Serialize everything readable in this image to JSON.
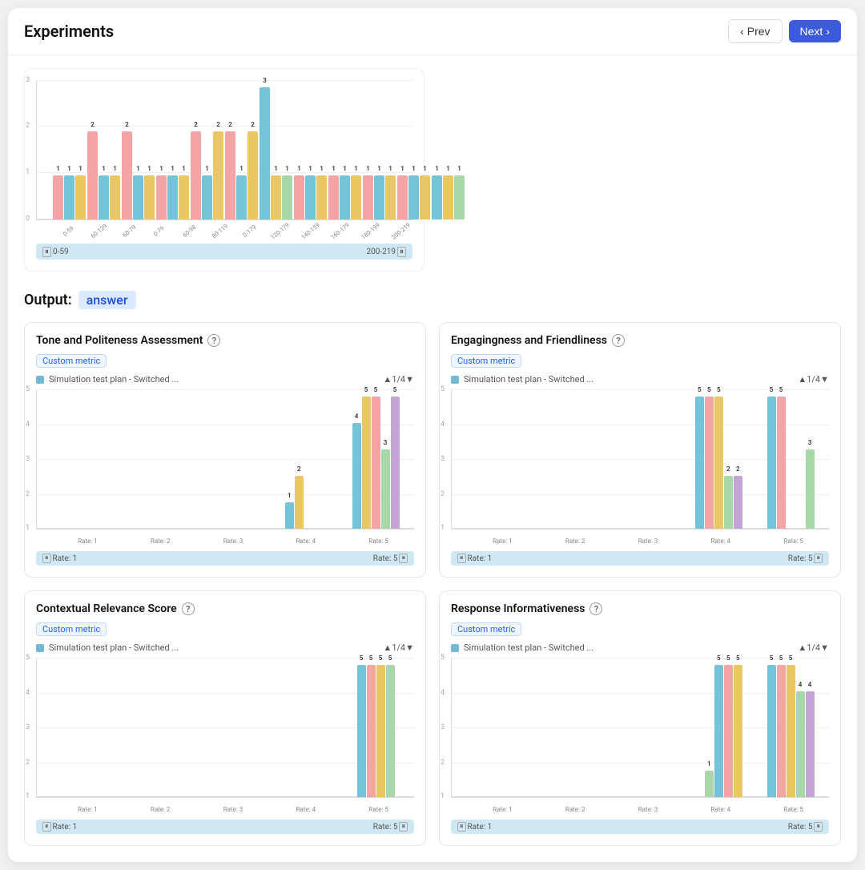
{
  "header": {
    "title": "Experiments",
    "prev_label": "Prev",
    "next_label": "Next"
  },
  "output_label": "Output:",
  "output_badge": "answer",
  "top_chart": {
    "y_labels": [
      "0",
      "1",
      "2",
      "3"
    ],
    "groups": [
      {
        "label": "0-59",
        "bars": [
          {
            "v": 1,
            "c": "#f4a4a4"
          },
          {
            "v": 1,
            "c": "#74c4d8"
          },
          {
            "v": 1,
            "c": "#ebc664"
          }
        ]
      },
      {
        "label": "60-139",
        "bars": [
          {
            "v": 2,
            "c": "#f4a4a4"
          },
          {
            "v": 1,
            "c": "#74c4d8"
          },
          {
            "v": 1,
            "c": "#ebc664"
          }
        ]
      },
      {
        "label": "60-79",
        "bars": [
          {
            "v": 2,
            "c": "#f4a4a4"
          },
          {
            "v": 1,
            "c": "#74c4d8"
          },
          {
            "v": 1,
            "c": "#ebc664"
          }
        ]
      },
      {
        "label": "0-79",
        "bars": [
          {
            "v": 1,
            "c": "#f4a4a4"
          },
          {
            "v": 1,
            "c": "#74c4d8"
          },
          {
            "v": 1,
            "c": "#ebc664"
          }
        ]
      },
      {
        "label": "60-98",
        "bars": [
          {
            "v": 2,
            "c": "#f4a4a4"
          },
          {
            "v": 1,
            "c": "#74c4d8"
          },
          {
            "v": 2,
            "c": "#ebc664"
          }
        ]
      },
      {
        "label": "80-119",
        "bars": [
          {
            "v": 2,
            "c": "#f4a4a4"
          },
          {
            "v": 1,
            "c": "#74c4d8"
          },
          {
            "v": 2,
            "c": "#ebc664"
          }
        ]
      },
      {
        "label": "0-179",
        "bars": [
          {
            "v": 3,
            "c": "#74c4d8"
          },
          {
            "v": 1,
            "c": "#ebc664"
          },
          {
            "v": 1,
            "c": "#a8d8a8"
          }
        ]
      },
      {
        "label": "120-179",
        "bars": [
          {
            "v": 1,
            "c": "#f4a4a4"
          },
          {
            "v": 1,
            "c": "#74c4d8"
          },
          {
            "v": 1,
            "c": "#ebc664"
          }
        ]
      },
      {
        "label": "140-159",
        "bars": [
          {
            "v": 1,
            "c": "#f4a4a4"
          },
          {
            "v": 1,
            "c": "#74c4d8"
          },
          {
            "v": 1,
            "c": "#ebc664"
          }
        ]
      },
      {
        "label": "160-179",
        "bars": [
          {
            "v": 1,
            "c": "#f4a4a4"
          },
          {
            "v": 1,
            "c": "#74c4d8"
          },
          {
            "v": 1,
            "c": "#ebc664"
          }
        ]
      },
      {
        "label": "180-199",
        "bars": [
          {
            "v": 1,
            "c": "#f4a4a4"
          },
          {
            "v": 1,
            "c": "#74c4d8"
          },
          {
            "v": 1,
            "c": "#ebc664"
          }
        ]
      },
      {
        "label": "200-219",
        "bars": [
          {
            "v": 1,
            "c": "#74c4d8"
          },
          {
            "v": 1,
            "c": "#ebc664"
          },
          {
            "v": 1,
            "c": "#a8d8a8"
          }
        ]
      }
    ],
    "slider_left": "0-59",
    "slider_right": "200-219"
  },
  "metrics": [
    {
      "id": "tone",
      "title": "Tone and Politeness Assessment",
      "badge": "Custom metric",
      "legend": "Simulation test plan - Switched ...",
      "nav": "▲1/4▼",
      "rates": [
        {
          "label": "Rate: 1",
          "bars": [
            {
              "v": 0,
              "c": "#f4a4a4"
            },
            {
              "v": 0,
              "c": "#74c4d8"
            },
            {
              "v": 0,
              "c": "#ebc664"
            },
            {
              "v": 0,
              "c": "#a8d8a8"
            }
          ]
        },
        {
          "label": "Rate: 2",
          "bars": [
            {
              "v": 0,
              "c": "#f4a4a4"
            },
            {
              "v": 0,
              "c": "#74c4d8"
            },
            {
              "v": 0,
              "c": "#ebc664"
            },
            {
              "v": 0,
              "c": "#a8d8a8"
            }
          ]
        },
        {
          "label": "Rate: 3",
          "bars": [
            {
              "v": 0,
              "c": "#f4a4a4"
            },
            {
              "v": 0,
              "c": "#74c4d8"
            },
            {
              "v": 0,
              "c": "#ebc664"
            },
            {
              "v": 0,
              "c": "#a8d8a8"
            }
          ]
        },
        {
          "label": "Rate: 4",
          "bars": [
            {
              "v": 1,
              "c": "#74c4d8"
            },
            {
              "v": 2,
              "c": "#ebc664"
            },
            {
              "v": 0,
              "c": "#f4a4a4"
            },
            {
              "v": 0,
              "c": "#a8d8a8"
            }
          ]
        },
        {
          "label": "Rate: 5",
          "bars": [
            {
              "v": 4,
              "c": "#74c4d8"
            },
            {
              "v": 5,
              "c": "#ebc664"
            },
            {
              "v": 5,
              "c": "#f4a4a4"
            },
            {
              "v": 3,
              "c": "#a8d8a8"
            },
            {
              "v": 5,
              "c": "#c4a4d4"
            }
          ]
        }
      ],
      "slider_left": "Rate: 1",
      "slider_right": "Rate: 5"
    },
    {
      "id": "engagingness",
      "title": "Engagingness and Friendliness",
      "badge": "Custom metric",
      "legend": "Simulation test plan - Switched ...",
      "nav": "▲1/4▼",
      "rates": [
        {
          "label": "Rate: 1",
          "bars": [
            {
              "v": 0,
              "c": "#f4a4a4"
            },
            {
              "v": 0,
              "c": "#74c4d8"
            },
            {
              "v": 0,
              "c": "#ebc664"
            },
            {
              "v": 0,
              "c": "#a8d8a8"
            }
          ]
        },
        {
          "label": "Rate: 2",
          "bars": [
            {
              "v": 0,
              "c": "#f4a4a4"
            },
            {
              "v": 0,
              "c": "#74c4d8"
            },
            {
              "v": 0,
              "c": "#ebc664"
            },
            {
              "v": 0,
              "c": "#a8d8a8"
            }
          ]
        },
        {
          "label": "Rate: 3",
          "bars": [
            {
              "v": 0,
              "c": "#f4a4a4"
            },
            {
              "v": 0,
              "c": "#74c4d8"
            },
            {
              "v": 0,
              "c": "#ebc664"
            },
            {
              "v": 0,
              "c": "#a8d8a8"
            }
          ]
        },
        {
          "label": "Rate: 4",
          "bars": [
            {
              "v": 5,
              "c": "#74c4d8"
            },
            {
              "v": 5,
              "c": "#f4a4a4"
            },
            {
              "v": 5,
              "c": "#ebc664"
            },
            {
              "v": 2,
              "c": "#a8d8a8"
            },
            {
              "v": 2,
              "c": "#c4a4d4"
            }
          ]
        },
        {
          "label": "Rate: 5",
          "bars": [
            {
              "v": 5,
              "c": "#74c4d8"
            },
            {
              "v": 5,
              "c": "#f4a4a4"
            },
            {
              "v": 0,
              "c": "#ebc664"
            },
            {
              "v": 0,
              "c": "#a8d8a8"
            },
            {
              "v": 3,
              "c": "#a8d8a8"
            }
          ]
        }
      ],
      "slider_left": "Rate: 1",
      "slider_right": "Rate: 5"
    },
    {
      "id": "contextual",
      "title": "Contextual Relevance Score",
      "badge": "Custom metric",
      "legend": "Simulation test plan - Switched ...",
      "nav": "▲1/4▼",
      "rates": [
        {
          "label": "Rate: 1",
          "bars": [
            {
              "v": 0,
              "c": "#f4a4a4"
            },
            {
              "v": 0,
              "c": "#74c4d8"
            },
            {
              "v": 0,
              "c": "#ebc664"
            },
            {
              "v": 0,
              "c": "#a8d8a8"
            }
          ]
        },
        {
          "label": "Rate: 2",
          "bars": [
            {
              "v": 0,
              "c": "#f4a4a4"
            },
            {
              "v": 0,
              "c": "#74c4d8"
            },
            {
              "v": 0,
              "c": "#ebc664"
            },
            {
              "v": 0,
              "c": "#a8d8a8"
            }
          ]
        },
        {
          "label": "Rate: 3",
          "bars": [
            {
              "v": 0,
              "c": "#f4a4a4"
            },
            {
              "v": 0,
              "c": "#74c4d8"
            },
            {
              "v": 0,
              "c": "#ebc664"
            },
            {
              "v": 0,
              "c": "#a8d8a8"
            }
          ]
        },
        {
          "label": "Rate: 4",
          "bars": [
            {
              "v": 0,
              "c": "#74c4d8"
            },
            {
              "v": 0,
              "c": "#f4a4a4"
            },
            {
              "v": 0,
              "c": "#ebc664"
            },
            {
              "v": 0,
              "c": "#a8d8a8"
            }
          ]
        },
        {
          "label": "Rate: 5",
          "bars": [
            {
              "v": 5,
              "c": "#74c4d8"
            },
            {
              "v": 5,
              "c": "#f4a4a4"
            },
            {
              "v": 5,
              "c": "#ebc664"
            },
            {
              "v": 5,
              "c": "#a8d8a8"
            }
          ]
        }
      ],
      "slider_left": "Rate: 1",
      "slider_right": "Rate: 5"
    },
    {
      "id": "response_info",
      "title": "Response Informativeness",
      "badge": "Custom metric",
      "legend": "Simulation test plan - Switched ...",
      "nav": "▲1/4▼",
      "rates": [
        {
          "label": "Rate: 1",
          "bars": [
            {
              "v": 0,
              "c": "#f4a4a4"
            },
            {
              "v": 0,
              "c": "#74c4d8"
            },
            {
              "v": 0,
              "c": "#ebc664"
            },
            {
              "v": 0,
              "c": "#a8d8a8"
            }
          ]
        },
        {
          "label": "Rate: 2",
          "bars": [
            {
              "v": 0,
              "c": "#f4a4a4"
            },
            {
              "v": 0,
              "c": "#74c4d8"
            },
            {
              "v": 0,
              "c": "#ebc664"
            },
            {
              "v": 0,
              "c": "#a8d8a8"
            }
          ]
        },
        {
          "label": "Rate: 3",
          "bars": [
            {
              "v": 0,
              "c": "#f4a4a4"
            },
            {
              "v": 0,
              "c": "#74c4d8"
            },
            {
              "v": 0,
              "c": "#ebc664"
            },
            {
              "v": 0,
              "c": "#a8d8a8"
            }
          ]
        },
        {
          "label": "Rate: 4",
          "bars": [
            {
              "v": 0,
              "c": "#74c4d8"
            },
            {
              "v": 1,
              "c": "#a8d8a8"
            },
            {
              "v": 5,
              "c": "#74c4d8"
            },
            {
              "v": 5,
              "c": "#f4a4a4"
            },
            {
              "v": 5,
              "c": "#ebc664"
            }
          ]
        },
        {
          "label": "Rate: 5",
          "bars": [
            {
              "v": 5,
              "c": "#74c4d8"
            },
            {
              "v": 5,
              "c": "#f4a4a4"
            },
            {
              "v": 5,
              "c": "#ebc664"
            },
            {
              "v": 4,
              "c": "#a8d8a8"
            },
            {
              "v": 4,
              "c": "#c4a4d4"
            }
          ]
        }
      ],
      "slider_left": "Rate: 1",
      "slider_right": "Rate: 5"
    }
  ]
}
